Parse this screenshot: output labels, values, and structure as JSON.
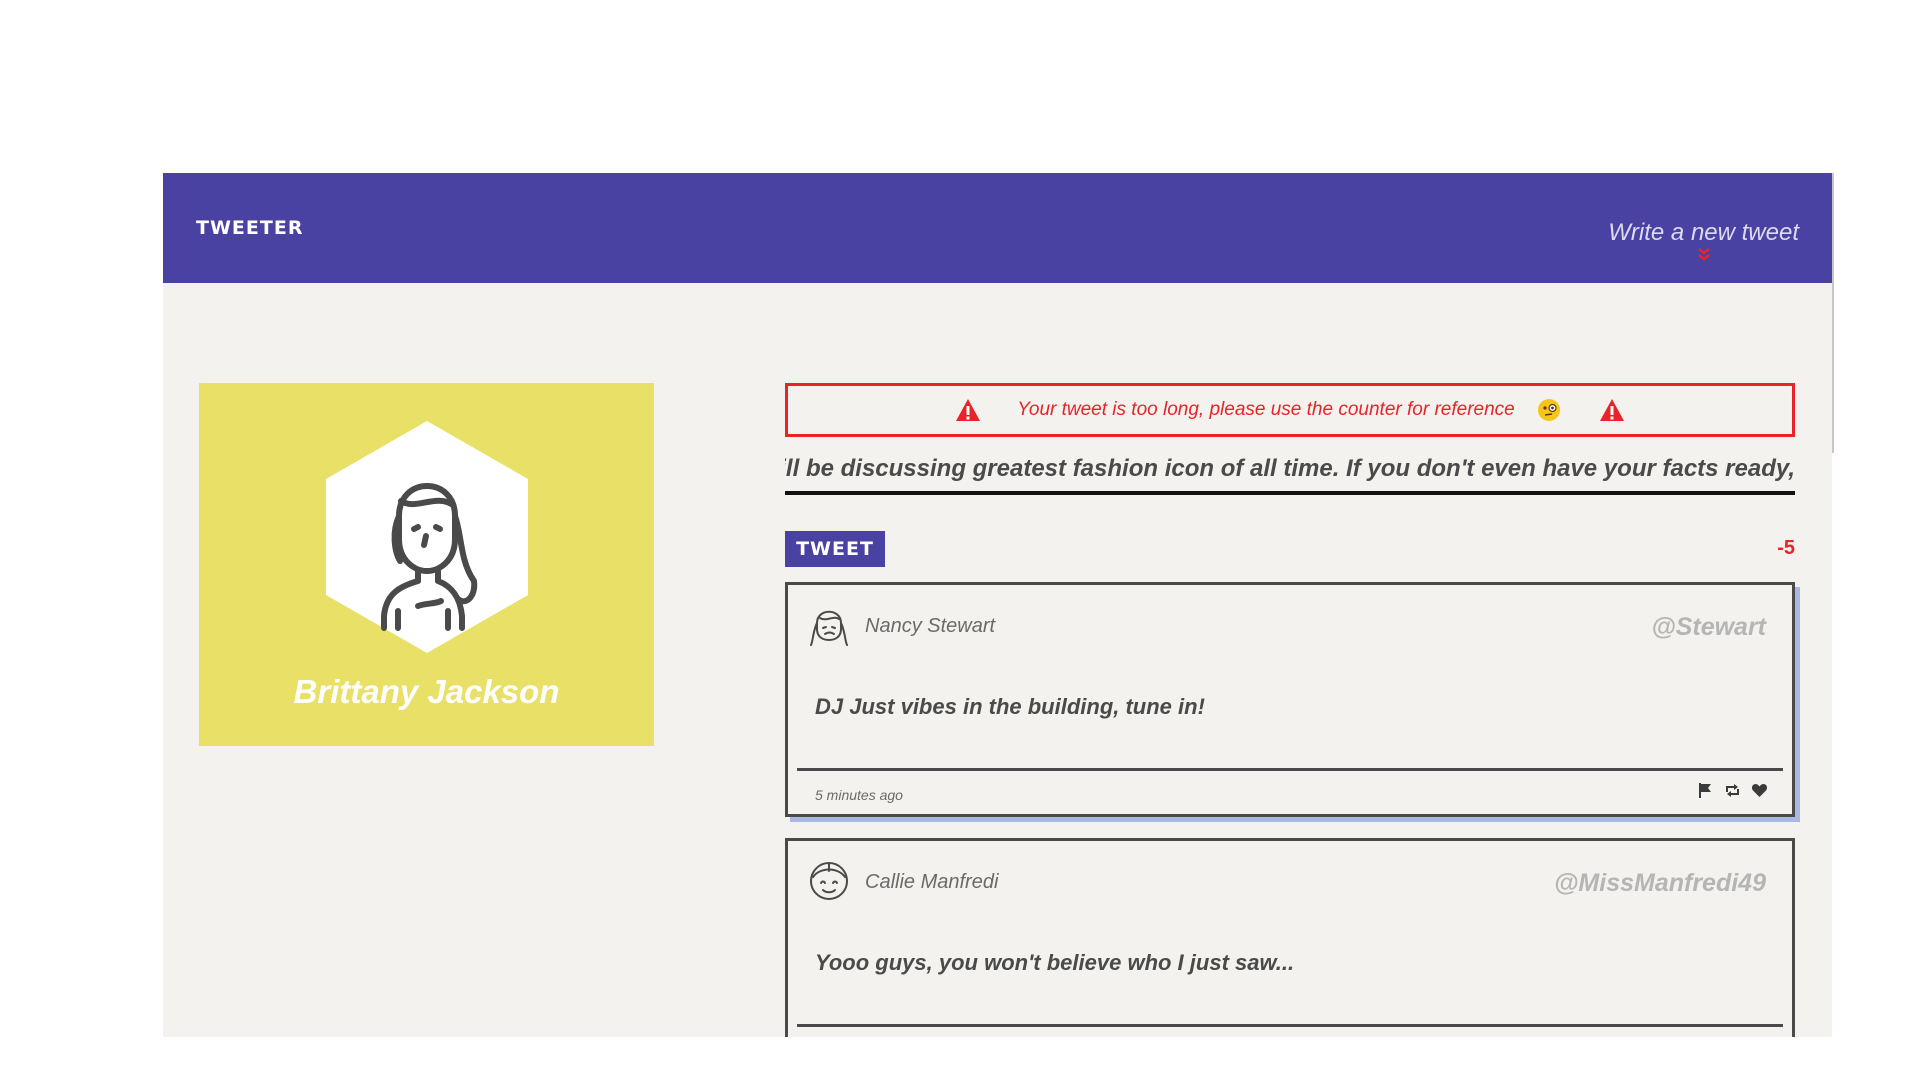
{
  "navbar": {
    "brand": "TWEETER",
    "compose_label": "Write a new tweet",
    "compose_icon": "double-chevron-down-icon"
  },
  "profile": {
    "name": "Brittany Jackson",
    "avatar_icon": "woman-avatar-icon",
    "background_color": "#e8e067"
  },
  "composer": {
    "error_message": "Your tweet is too long, please use the counter for reference",
    "error_icon": "warning-triangle-icon",
    "error_emoji": "face-with-monocle-emoji",
    "input_value": "ill be discussing greatest fashion icon of all time. If you don't even have your facts ready,",
    "submit_label": "TWEET",
    "counter": "-5"
  },
  "tweets": [
    {
      "name": "Nancy Stewart",
      "handle": "@Stewart",
      "text": "DJ Just vibes in the building, tune in!",
      "timestamp": "5 minutes ago",
      "avatar_icon": "woman-avatar-icon"
    },
    {
      "name": "Callie Manfredi",
      "handle": "@MissManfredi49",
      "text": "Yooo guys, you won't believe who I just saw...",
      "avatar_icon": "smiling-woman-avatar-icon"
    }
  ],
  "colors": {
    "brand": "#4a42a3",
    "error": "#e8232a",
    "background": "#f3f2ee"
  }
}
